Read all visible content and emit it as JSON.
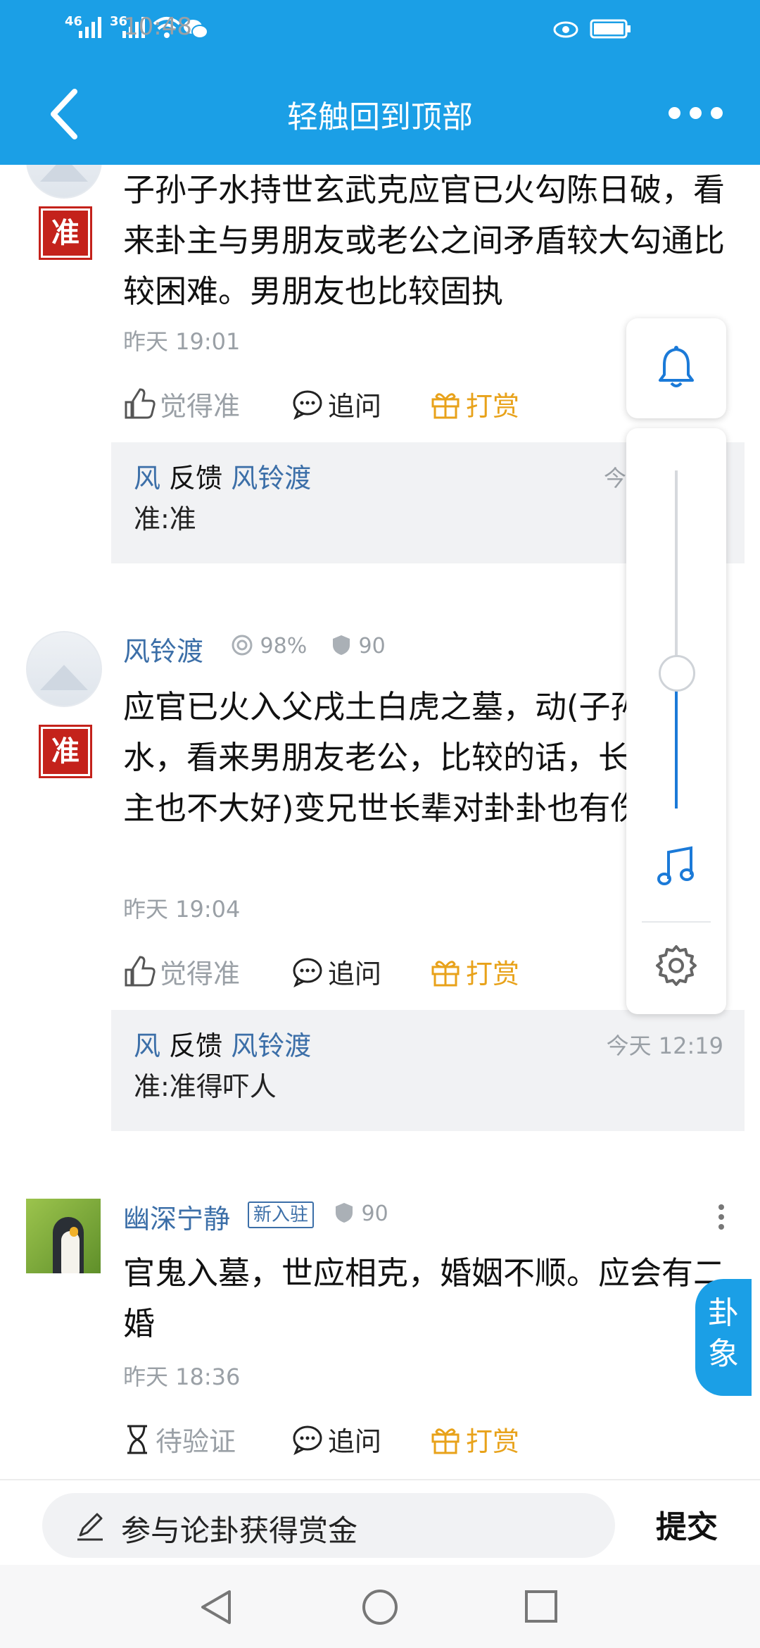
{
  "status_bar": {
    "signal1": "46",
    "signal2": "36",
    "time": "10:48"
  },
  "header": {
    "title": "轻触回到顶部"
  },
  "comments": [
    {
      "text": "子孙子水持世玄武克应官已火勾陈日破，看来卦主与男朋友或老公之间矛盾较大勾通比较困难。男朋友也比较固执",
      "seal": "准",
      "time": "昨天 19:01",
      "actions": {
        "like": "觉得准",
        "ask": "追问",
        "reward": "打赏"
      },
      "reply": {
        "from": "风",
        "verb": "反馈",
        "to": "风铃渡",
        "time": "今",
        "text": "准:准"
      }
    },
    {
      "author": "风铃渡",
      "accuracy": "98%",
      "credit": "90",
      "seal": "准",
      "text": "应官已火入父戌土白虎之墓，动(子孙子水，看来男朋友老公，比较的话，长辈对卦主也不大好)变兄世长辈对卦卦也有伤害",
      "time": "昨天 19:04",
      "actions": {
        "like": "觉得准",
        "ask": "追问",
        "reward": "打赏"
      },
      "reply": {
        "from": "风",
        "verb": "反馈",
        "to": "风铃渡",
        "time": "今天 12:19",
        "text": "准:准得吓人"
      }
    },
    {
      "author": "幽深宁静",
      "badge": "新入驻",
      "credit": "90",
      "text": "官鬼入墓，世应相克，婚姻不顺。应会有二婚",
      "time": "昨天 18:36",
      "actions": {
        "pending": "待验证",
        "ask": "追问",
        "reward": "打赏"
      }
    }
  ],
  "float_tab": {
    "line1": "卦",
    "line2": "象"
  },
  "volume_level": 0.4,
  "bottom": {
    "placeholder": "参与论卦获得赏金",
    "submit": "提交"
  },
  "icons": [
    "back-icon",
    "more-icon",
    "bell-icon",
    "music-note-icon",
    "gear-icon",
    "thumb-up-icon",
    "chat-bubble-icon",
    "gift-icon",
    "hourglass-icon",
    "pencil-icon",
    "nav-back-icon",
    "nav-home-icon",
    "nav-recents-icon"
  ],
  "colors": {
    "brand": "#1b9fe6",
    "link": "#3c6fa8",
    "gold": "#e8a21a",
    "seal": "#c4221b"
  }
}
